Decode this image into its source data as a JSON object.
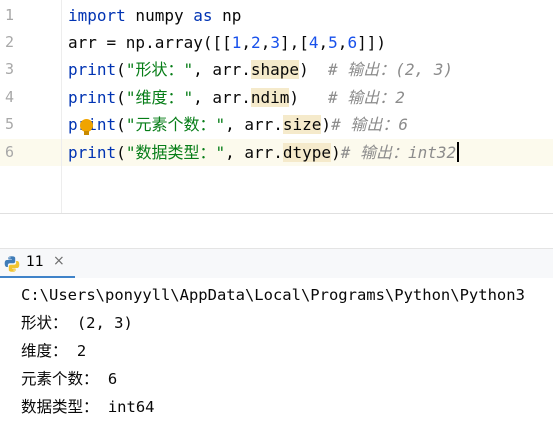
{
  "editor": {
    "line_numbers": [
      "1",
      "2",
      "3",
      "4",
      "5",
      "6"
    ],
    "lines": [
      [
        {
          "t": "import",
          "c": "kw"
        },
        {
          "t": " numpy ",
          "c": ""
        },
        {
          "t": "as",
          "c": "kw"
        },
        {
          "t": " np",
          "c": ""
        }
      ],
      [
        {
          "t": "arr = np.array([[",
          "c": ""
        },
        {
          "t": "1",
          "c": "num"
        },
        {
          "t": ",",
          "c": ""
        },
        {
          "t": "2",
          "c": "num"
        },
        {
          "t": ",",
          "c": ""
        },
        {
          "t": "3",
          "c": "num"
        },
        {
          "t": "],[",
          "c": ""
        },
        {
          "t": "4",
          "c": "num"
        },
        {
          "t": ",",
          "c": ""
        },
        {
          "t": "5",
          "c": "num"
        },
        {
          "t": ",",
          "c": ""
        },
        {
          "t": "6",
          "c": "num"
        },
        {
          "t": "]])",
          "c": ""
        }
      ],
      [
        {
          "t": "print",
          "c": "kw"
        },
        {
          "t": "(",
          "c": ""
        },
        {
          "t": "\"形状：\"",
          "c": "str"
        },
        {
          "t": ", arr.",
          "c": ""
        },
        {
          "t": "shape",
          "c": "attr"
        },
        {
          "t": ")  ",
          "c": ""
        },
        {
          "t": "# 输出：(2, 3)",
          "c": "cmt"
        }
      ],
      [
        {
          "t": "print",
          "c": "kw"
        },
        {
          "t": "(",
          "c": ""
        },
        {
          "t": "\"维度：\"",
          "c": "str"
        },
        {
          "t": ", arr.",
          "c": ""
        },
        {
          "t": "ndim",
          "c": "attr"
        },
        {
          "t": ")   ",
          "c": ""
        },
        {
          "t": "# 输出：2",
          "c": "cmt"
        }
      ],
      [
        {
          "t": "print",
          "c": "kw"
        },
        {
          "t": "(",
          "c": ""
        },
        {
          "t": "\"元素个数：\"",
          "c": "str"
        },
        {
          "t": ", arr.",
          "c": ""
        },
        {
          "t": "size",
          "c": "attr"
        },
        {
          "t": ")",
          "c": ""
        },
        {
          "t": "# 输出：6",
          "c": "cmt"
        }
      ],
      [
        {
          "t": "print",
          "c": "kw"
        },
        {
          "t": "(",
          "c": ""
        },
        {
          "t": "\"数据类型：\"",
          "c": "str"
        },
        {
          "t": ", arr.",
          "c": ""
        },
        {
          "t": "dtype",
          "c": "attr"
        },
        {
          "t": ")",
          "c": ""
        },
        {
          "t": "# 输出：int32",
          "c": "cmt"
        }
      ]
    ],
    "current_line": 6
  },
  "run_panel": {
    "tab_label": "11",
    "close_glyph": "×",
    "icon": "python-icon"
  },
  "console": {
    "path_line": "C:\\Users\\ponyyll\\AppData\\Local\\Programs\\Python\\Python3",
    "outputs": [
      "形状： (2, 3)",
      "维度： 2",
      "元素个数： 6",
      "数据类型： int64"
    ]
  },
  "colors": {
    "keyword": "#0033b3",
    "string": "#067d17",
    "number": "#1750eb",
    "comment": "#8c8c8c",
    "attribute_highlight": "#f5eacb",
    "current_line_bg": "#fcfaed",
    "tab_underline": "#4083c9"
  }
}
